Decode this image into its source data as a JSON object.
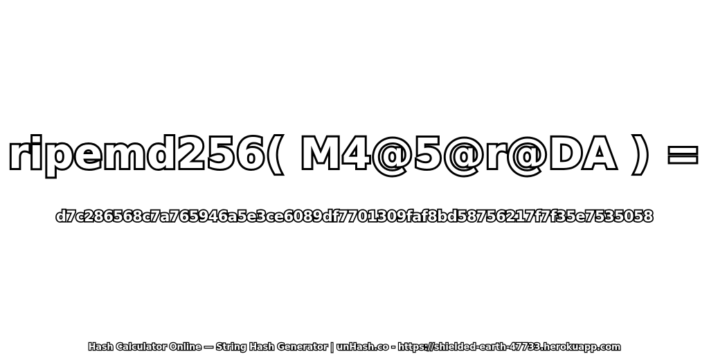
{
  "hash": {
    "expression": "ripemd256( M4@5@r@DA ) =",
    "digest": "d7c286568c7a765946a5e3ce6089df7701309faf8bd58756217f7f35e7535058"
  },
  "footer": {
    "text": "Hash Calculator Online — String Hash Generator | unHash.co - https://shielded-earth-47733.herokuapp.com"
  },
  "colors": {
    "background": "#ffffff",
    "text_fill": "#ffffff",
    "text_outline": "#000000"
  }
}
